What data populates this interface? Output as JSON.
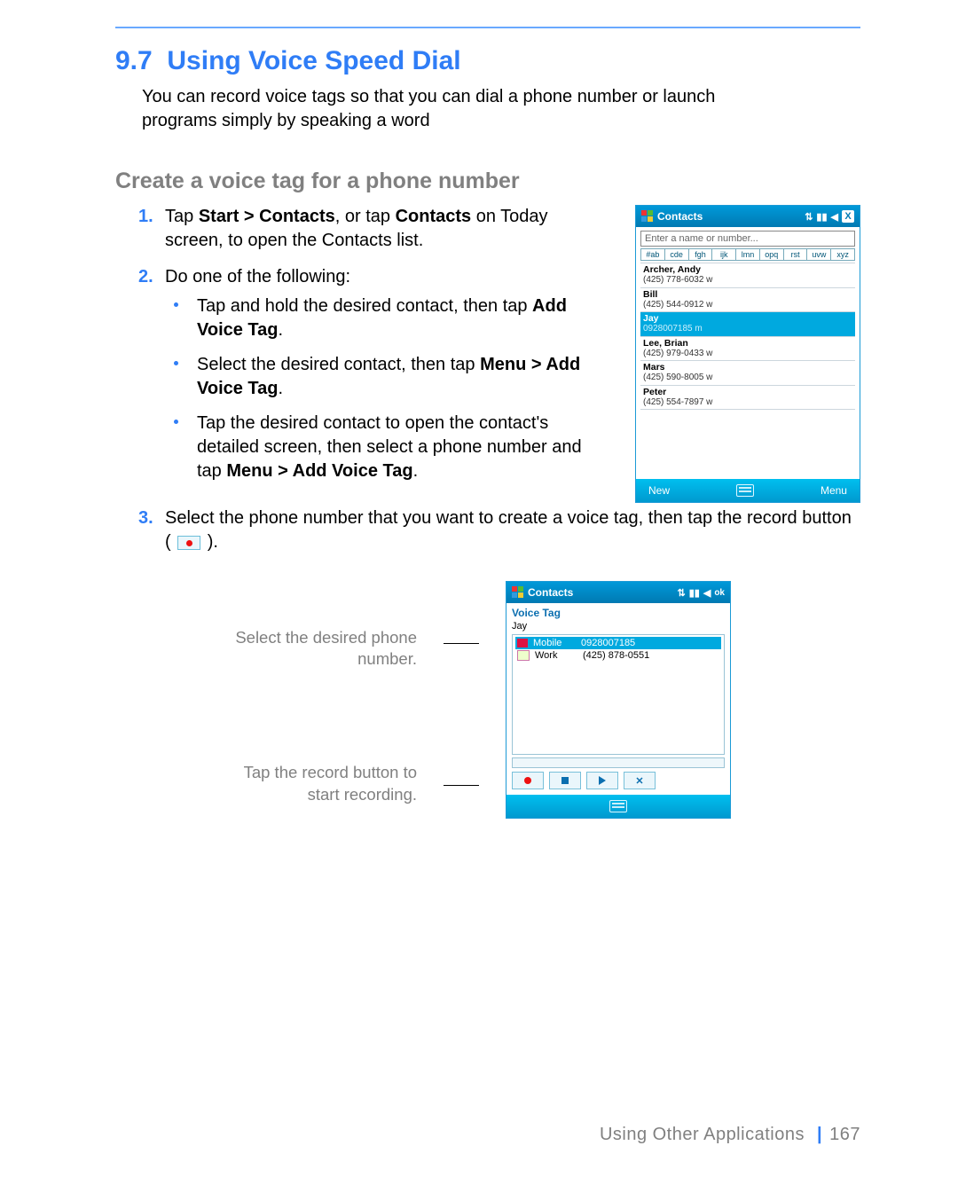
{
  "section_number": "9.7",
  "section_title": "Using Voice Speed Dial",
  "intro": "You can record voice tags so that you can dial a phone number or launch programs simply by speaking a word",
  "subhead": "Create a voice tag for a phone number",
  "steps": {
    "s1a": "Tap ",
    "s1b": "Start > Contacts",
    "s1c": ", or tap ",
    "s1d": "Contacts",
    "s1e": " on Today screen, to open the Contacts list.",
    "s2": "Do one of the following:",
    "b1a": "Tap and hold the desired contact, then tap ",
    "b1b": "Add Voice Tag",
    "b1c": ".",
    "b2a": "Select the desired contact, then tap ",
    "b2b": "Menu > Add Voice Tag",
    "b2c": ".",
    "b3a": "Tap the desired contact to open the contact's detailed screen, then select a phone number and tap ",
    "b3b": "Menu > Add Voice Tag",
    "b3c": ".",
    "s3a": "Select the phone number that you want to create a voice tag, then tap the record button ( ",
    "s3b": " )."
  },
  "callout1": "Select the desired phone number.",
  "callout2": "Tap the record button to start recording.",
  "phone1": {
    "title": "Contacts",
    "close": "X",
    "search_placeholder": "Enter a name or number...",
    "alpha": [
      "#ab",
      "cde",
      "fgh",
      "ijk",
      "lmn",
      "opq",
      "rst",
      "uvw",
      "xyz"
    ],
    "contacts": [
      {
        "name": "Archer, Andy",
        "sub": "(425) 778-6032  w"
      },
      {
        "name": "Bill",
        "sub": "(425) 544-0912  w"
      },
      {
        "name": "Jay",
        "sub": "0928007185  m",
        "sel": true
      },
      {
        "name": "Lee, Brian",
        "sub": "(425) 979-0433  w"
      },
      {
        "name": "Mars",
        "sub": "(425) 590-8005  w"
      },
      {
        "name": "Peter",
        "sub": "(425) 554-7897  w"
      }
    ],
    "soft_left": "New",
    "soft_right": "Menu"
  },
  "phone2": {
    "title": "Contacts",
    "ok": "ok",
    "heading": "Voice Tag",
    "contact_name": "Jay",
    "rows": [
      {
        "label": "Mobile",
        "num": "0928007185",
        "sel": true,
        "icon": "home"
      },
      {
        "label": "Work",
        "num": "(425) 878-0551",
        "sel": false,
        "icon": "work"
      }
    ],
    "del": "✕"
  },
  "footer_text": "Using Other Applications",
  "footer_sep": "|",
  "footer_page": "167"
}
